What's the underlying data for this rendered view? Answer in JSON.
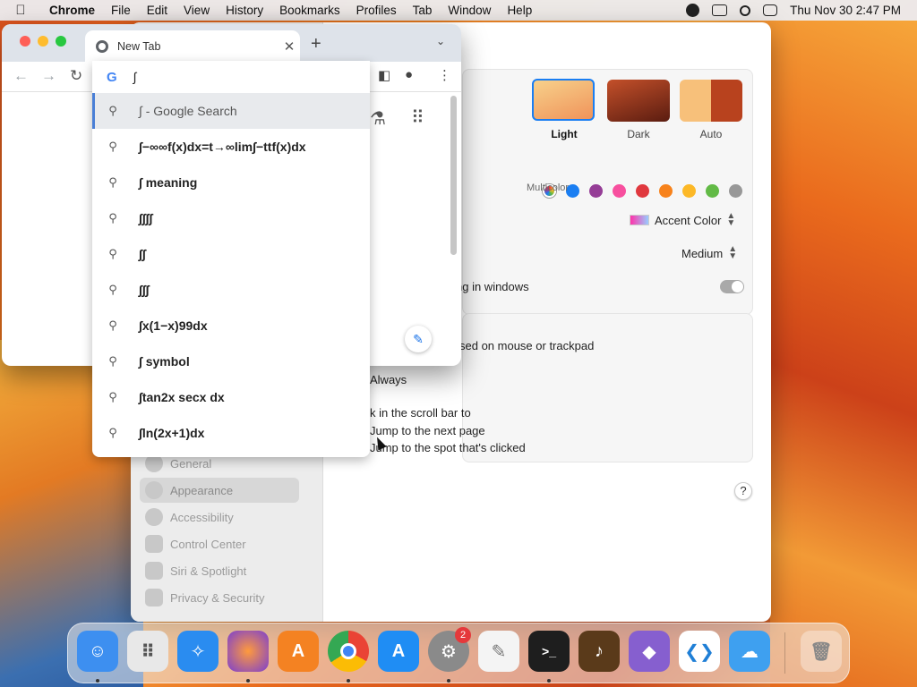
{
  "menubar": {
    "app_name": "Chrome",
    "menus": [
      "File",
      "Edit",
      "View",
      "History",
      "Bookmarks",
      "Profiles",
      "Tab",
      "Window",
      "Help"
    ],
    "clock": "Thu Nov 30  2:47 PM"
  },
  "chrome": {
    "tab_title": "New Tab",
    "omnibox_value": "∫",
    "suggestions": [
      "∫ - Google Search",
      "∫−∞∞f(x)dx=t→∞lim∫−ttf(x)dx",
      "∫ meaning",
      "∫∫∫∫",
      "∫∫",
      "∫∫∫",
      "∫x(1−x)99dx",
      "∫ symbol",
      "∫tan2x secx dx",
      "∫ln(2x+1)dx"
    ]
  },
  "settings": {
    "sidebar": [
      "General",
      "Appearance",
      "Accessibility",
      "Control Center",
      "Siri & Spotlight",
      "Privacy & Security"
    ],
    "selected_sidebar": "Appearance",
    "themes": [
      {
        "label": "Light",
        "selected": true
      },
      {
        "label": "Dark",
        "selected": false
      },
      {
        "label": "Auto",
        "selected": false
      }
    ],
    "accent_label": "Multicolor",
    "accent_colors": [
      "#b36ae2",
      "#1a7ef2",
      "#953d96",
      "#f74f9e",
      "#e0383e",
      "#f7821b",
      "#fcb827",
      "#62ba46",
      "#989898"
    ],
    "highlight_color_value": "Accent Color",
    "sidebar_icon_size_value": "Medium",
    "tinting_text": "ng in windows",
    "scroll_text": "sed on mouse or trackpad",
    "always_text": "Always",
    "click_text": "k in the scroll bar to",
    "jump_next": "Jump to the next page",
    "jump_spot": "Jump to the spot that's clicked",
    "help": "?"
  },
  "dock": {
    "apps": [
      {
        "name": "Finder",
        "color": "#3d8ff0"
      },
      {
        "name": "Launchpad",
        "color": "#e8e8e8"
      },
      {
        "name": "Safari",
        "color": "#2a8cf0"
      },
      {
        "name": "Firefox",
        "color": "#7b3fd1"
      },
      {
        "name": "Avast",
        "color": "#f48222"
      },
      {
        "name": "Chrome",
        "color": "#ffffff"
      },
      {
        "name": "App Store",
        "color": "#1f8df4"
      },
      {
        "name": "System Settings",
        "color": "#8a8a8a"
      },
      {
        "name": "TextEdit",
        "color": "#f4f4f4"
      },
      {
        "name": "Terminal",
        "color": "#1e1e1e"
      },
      {
        "name": "Instruments",
        "color": "#5a3a1a"
      },
      {
        "name": "Visual Studio",
        "color": "#865fcf"
      },
      {
        "name": "VS Code",
        "color": "#ffffff"
      },
      {
        "name": "Weather",
        "color": "#3ea0f0"
      }
    ],
    "settings_badge": "2"
  }
}
